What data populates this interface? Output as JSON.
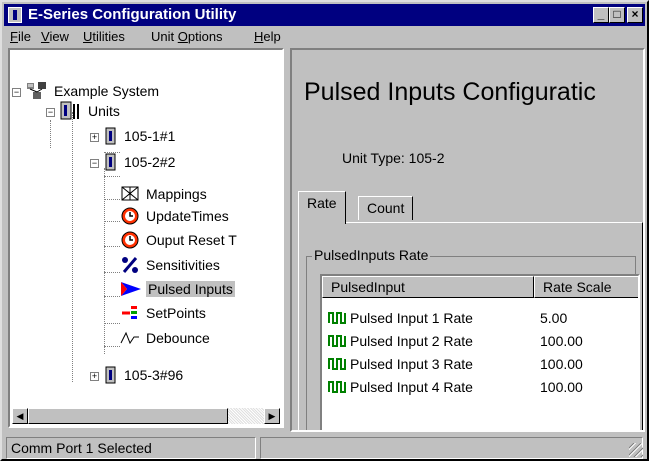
{
  "window": {
    "title": "E-Series Configuration Utility",
    "buttons": {
      "minimize": "_",
      "maximize": "□",
      "close": "×"
    }
  },
  "menu": [
    {
      "label": "File",
      "accel": "F",
      "rest": "ile"
    },
    {
      "label": "View",
      "accel": "V",
      "rest": "iew"
    },
    {
      "label": "Utilities",
      "accel": "U",
      "rest": "tilities"
    },
    {
      "label": "Unit Options",
      "pre": "Unit ",
      "accel": "O",
      "rest": "ptions"
    },
    {
      "label": "Help",
      "accel": "H",
      "rest": "elp"
    }
  ],
  "tree": {
    "root": "Example System",
    "units": "Units",
    "unit_a": "105-1#1",
    "unit_b": "105-2#2",
    "children": [
      {
        "label": "Mappings",
        "icon": "mappings-icon"
      },
      {
        "label": "UpdateTimes",
        "icon": "clock-icon"
      },
      {
        "label": "Ouput Reset T",
        "icon": "clock-icon"
      },
      {
        "label": "Sensitivities",
        "icon": "percent-icon"
      },
      {
        "label": "Pulsed Inputs",
        "icon": "pulse-arrow-icon"
      },
      {
        "label": "SetPoints",
        "icon": "setpoints-icon"
      },
      {
        "label": "Debounce",
        "icon": "debounce-wave-icon"
      }
    ],
    "unit_c": "105-3#96",
    "selected": "Pulsed Inputs"
  },
  "panel": {
    "title": "Pulsed Inputs Configuratic",
    "unit_type_label": "Unit Type:",
    "unit_type_value": "105-2",
    "tabs": [
      "Rate",
      "Count"
    ],
    "active_tab": "Rate",
    "group_label": "PulsedInputs Rate",
    "columns": [
      "PulsedInput",
      "Rate Scale"
    ],
    "rows": [
      {
        "name": "Pulsed Input 1 Rate",
        "rate": "5.00"
      },
      {
        "name": "Pulsed Input 2 Rate",
        "rate": "100.00"
      },
      {
        "name": "Pulsed Input 3 Rate",
        "rate": "100.00"
      },
      {
        "name": "Pulsed Input 4 Rate",
        "rate": "100.00"
      }
    ]
  },
  "status": {
    "text": "Comm Port 1 Selected"
  },
  "colors": {
    "titlebar": "#000080",
    "face": "#c0c0c0",
    "pulse_icon_green": "#008000",
    "arrow_blue": "#0000ff"
  }
}
